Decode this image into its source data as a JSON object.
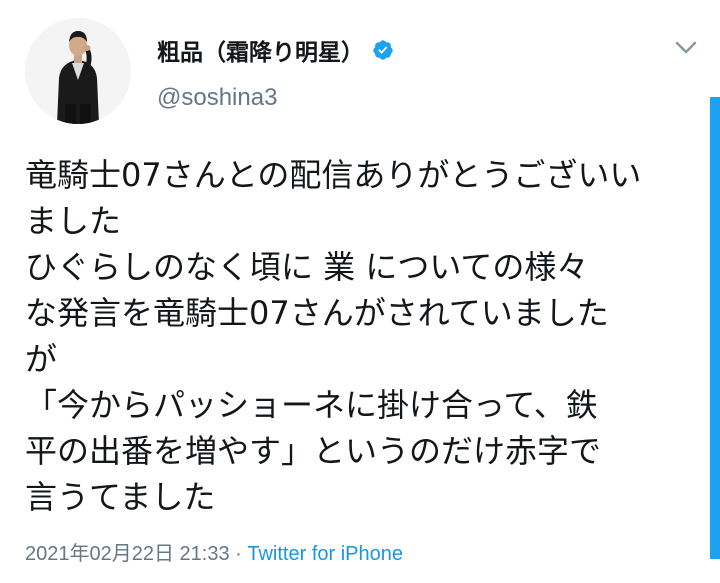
{
  "author": {
    "display_name": "粗品（霜降り明星）",
    "handle": "@soshina3",
    "verified": true
  },
  "tweet": {
    "lines": [
      "竜騎士07さんとの配信ありがとうございい",
      "ました",
      "ひぐらしのなく頃に 業 についての様々",
      "な発言を竜騎士07さんがされていました",
      "が",
      "「今からパッショーネに掛け合って、鉄",
      "平の出番を増やす」というのだけ赤字で",
      "言うてました"
    ],
    "timestamp": "2021年02月22日 21:33",
    "separator": " · ",
    "source": "Twitter for iPhone"
  },
  "icons": {
    "verified": "verified-badge-icon",
    "menu": "chevron-down-icon"
  },
  "colors": {
    "verified_blue": "#1da1f2",
    "link_blue": "#1b95e0",
    "secondary_text": "#657786",
    "primary_text": "#14171a"
  }
}
